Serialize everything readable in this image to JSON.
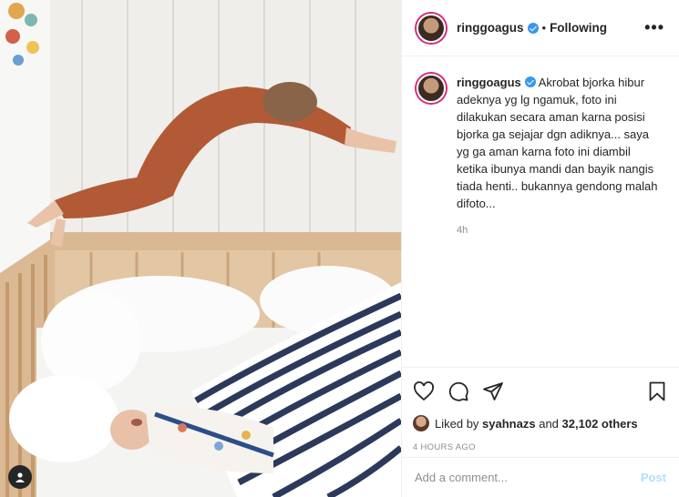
{
  "post": {
    "username": "ringgoagus",
    "separator": "•",
    "follow_status": "Following",
    "more_label": "•••",
    "caption": "Akrobat bjorka hibur adeknya yg lg ngamuk, foto ini dilakukan secara aman karna posisi bjorka ga sejajar dgn adiknya... saya yg ga aman karna foto ini diambil ketika ibunya mandi dan bayik nangis tiada henti.. bukannya gendong malah difoto...",
    "caption_age": "4h",
    "likes": {
      "prefix": "Liked by",
      "user": "syahnazs",
      "middle": "and",
      "count": "32,102 others"
    },
    "posted_ago": "4 HOURS AGO",
    "comment_placeholder": "Add a comment...",
    "post_label": "Post"
  },
  "icons": {
    "like": "heart-icon",
    "comment": "comment-icon",
    "share": "share-icon",
    "save": "bookmark-icon",
    "tag": "user-tag-icon"
  },
  "colors": {
    "verified": "#3897f0",
    "post_button": "#b2dffc",
    "muted": "#8e8e8e"
  }
}
